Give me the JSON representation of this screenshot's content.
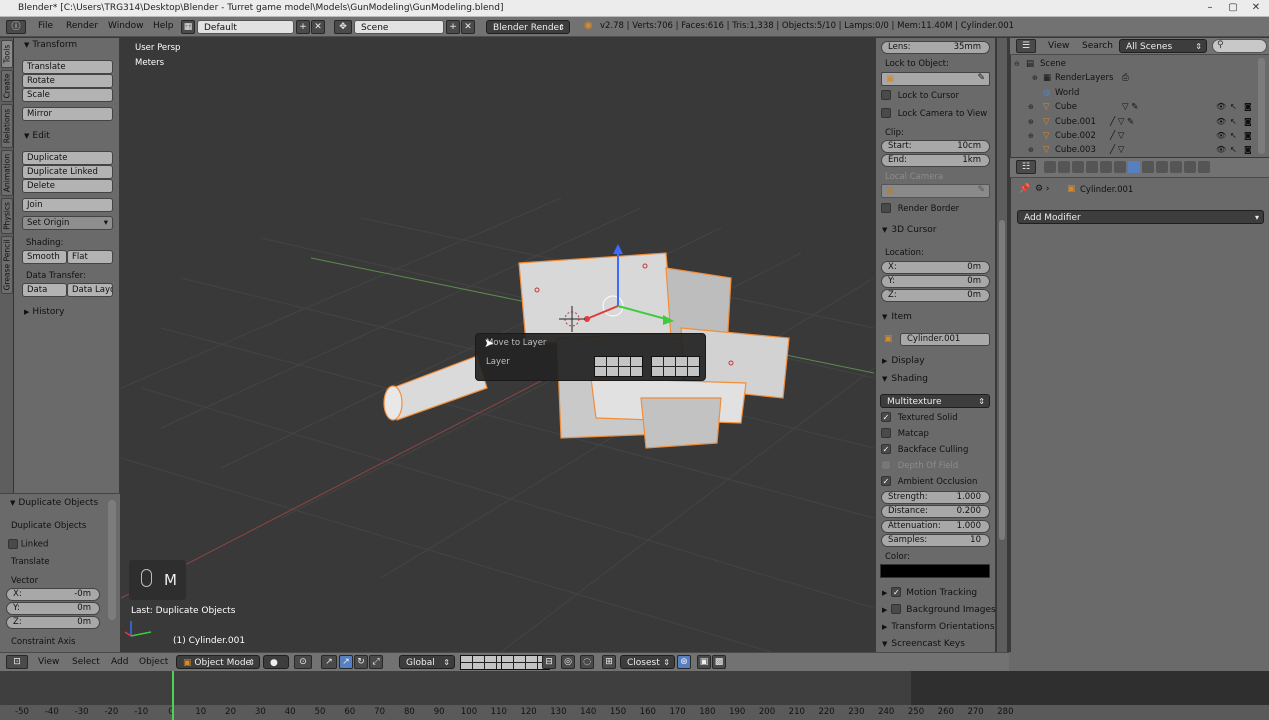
{
  "window": {
    "title": "Blender* [C:\\Users\\TRG314\\Desktop\\Blender - Turret game model\\Models\\GunModeling\\GunModeling.blend]"
  },
  "topbar": {
    "menus": [
      "File",
      "Render",
      "Window",
      "Help"
    ],
    "layout": "Default",
    "scene": "Scene",
    "engine": "Blender Render",
    "stats": "v2.78 | Verts:706 | Faces:616 | Tris:1,338 | Objects:5/10 | Lamps:0/0 | Mem:11.40M | Cylinder.001"
  },
  "vtabs": [
    "Tools",
    "Create",
    "Relations",
    "Animation",
    "Physics",
    "Grease Pencil"
  ],
  "toolshelf": {
    "transform": {
      "title": "Transform",
      "buttons": [
        "Translate",
        "Rotate",
        "Scale",
        "Mirror"
      ]
    },
    "edit": {
      "title": "Edit",
      "buttons": [
        "Duplicate",
        "Duplicate Linked",
        "Delete",
        "Join"
      ],
      "set_origin": "Set Origin"
    },
    "shading": {
      "label": "Shading:",
      "smooth": "Smooth",
      "flat": "Flat"
    },
    "data_transfer": {
      "label": "Data Transfer:",
      "data": "Data",
      "data_layout": "Data Layo"
    },
    "history": "History"
  },
  "redo": {
    "title": "Duplicate Objects",
    "op_label": "Duplicate Objects",
    "linked": "Linked",
    "translate": "Translate",
    "vector": "Vector",
    "x": {
      "label": "X:",
      "value": "-0m"
    },
    "y": {
      "label": "Y:",
      "value": "0m"
    },
    "z": {
      "label": "Z:",
      "value": "0m"
    },
    "constraint": "Constraint Axis"
  },
  "viewport": {
    "view_name": "User Persp",
    "units": "Meters",
    "last_op": "Last: Duplicate Objects",
    "object_label": "(1) Cylinder.001",
    "key": "M",
    "move_layer": {
      "title": "Move to Layer",
      "layer": "Layer"
    }
  },
  "nprops": {
    "lens": {
      "label": "Lens:",
      "value": "35mm"
    },
    "lock_to_object": "Lock to Object:",
    "lock_to_cursor": "Lock to Cursor",
    "lock_camera": "Lock Camera to View",
    "clip": "Clip:",
    "start": {
      "label": "Start:",
      "value": "10cm"
    },
    "end": {
      "label": "End:",
      "value": "1km"
    },
    "local_camera": "Local Camera",
    "render_border": "Render Border",
    "cursor": {
      "title": "3D Cursor",
      "location": "Location:",
      "x": {
        "label": "X:",
        "value": "0m"
      },
      "y": {
        "label": "Y:",
        "value": "0m"
      },
      "z": {
        "label": "Z:",
        "value": "0m"
      }
    },
    "item": {
      "title": "Item",
      "name": "Cylinder.001"
    },
    "display": "Display",
    "shading": {
      "title": "Shading",
      "mode": "Multitexture",
      "textured_solid": "Textured Solid",
      "matcap": "Matcap",
      "backface": "Backface Culling",
      "dof": "Depth Of Field",
      "ao": "Ambient Occlusion",
      "strength": {
        "label": "Strength:",
        "value": "1.000"
      },
      "distance": {
        "label": "Distance:",
        "value": "0.200"
      },
      "attenuation": {
        "label": "Attenuation:",
        "value": "1.000"
      },
      "samples": {
        "label": "Samples:",
        "value": "10"
      },
      "color": "Color:"
    },
    "motion_tracking": "Motion Tracking",
    "background_images": "Background Images",
    "transform_orientations": "Transform Orientations",
    "screencast_keys": "Screencast Keys"
  },
  "outliner": {
    "view": "View",
    "search": "Search",
    "filter": "All Scenes",
    "rows": [
      "Scene",
      "RenderLayers",
      "World",
      "Cube",
      "Cube.001",
      "Cube.002",
      "Cube.003"
    ]
  },
  "properties": {
    "object": "Cylinder.001",
    "add_modifier": "Add Modifier"
  },
  "bottombar": {
    "menus": [
      "View",
      "Select",
      "Add",
      "Object"
    ],
    "mode": "Object Mode",
    "orientation": "Global",
    "snap": "Closest"
  },
  "timeline": {
    "ticks": [
      "-50",
      "-40",
      "-30",
      "-20",
      "-10",
      "0",
      "10",
      "20",
      "30",
      "40",
      "50",
      "60",
      "70",
      "80",
      "90",
      "100",
      "110",
      "120",
      "130",
      "140",
      "150",
      "160",
      "170",
      "180",
      "190",
      "200",
      "210",
      "220",
      "230",
      "240",
      "250",
      "260",
      "270",
      "280"
    ]
  },
  "colors": {
    "accent": "#5680c2",
    "selected_outline": "#f08e3c",
    "playhead": "#50d050"
  }
}
